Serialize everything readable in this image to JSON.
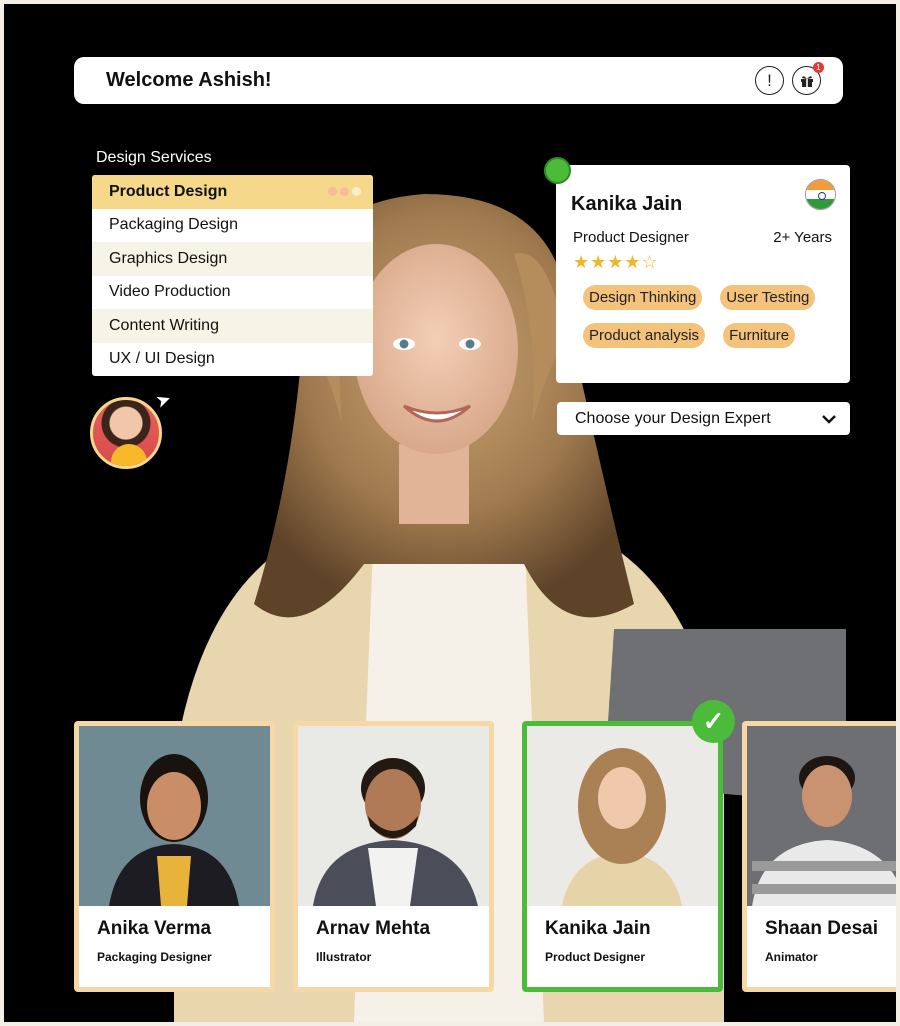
{
  "header": {
    "welcome": "Welcome Ashish!",
    "alert_icon": "!",
    "notif_count": "1"
  },
  "services": {
    "label": "Design Services",
    "items": [
      "Product Design",
      "Packaging Design",
      "Graphics Design",
      "Video Production",
      "Content Writing",
      "UX / UI Design"
    ]
  },
  "profile": {
    "name": "Kanika Jain",
    "role": "Product Designer",
    "experience": "2+ Years",
    "rating": 4,
    "stars": "★★★★☆",
    "tags": [
      "Design Thinking",
      "User Testing",
      "Product analysis",
      "Furniture"
    ]
  },
  "dropdown": {
    "label": "Choose your Design Expert",
    "chevron": "⌄"
  },
  "experts": [
    {
      "name": "Anika Verma",
      "role": "Packaging Designer"
    },
    {
      "name": "Arnav Mehta",
      "role": "Illustrator"
    },
    {
      "name": "Kanika Jain",
      "role": "Product Designer"
    },
    {
      "name": "Shaan Desai",
      "role": "Animator"
    }
  ],
  "colors": {
    "accent": "#f5d88a",
    "selected": "#4cbb3a",
    "tag": "#f5c27c"
  }
}
